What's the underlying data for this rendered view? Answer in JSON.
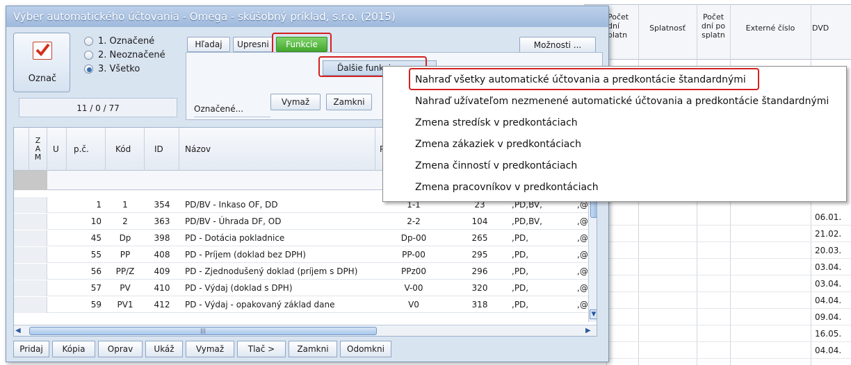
{
  "window": {
    "title": "Výber automatického účtovania - Omega - skúšobný príklad, s.r.o. (2015)"
  },
  "mark_button": {
    "label": "Označ",
    "icon": "checkbox-checked-icon"
  },
  "radios": [
    {
      "label": "1. Označené",
      "selected": false
    },
    {
      "label": "2. Neoznačené",
      "selected": false
    },
    {
      "label": "3. Všetko",
      "selected": true
    }
  ],
  "counter": "11 / 0 / 77",
  "tabs": [
    {
      "label": "Hľadaj"
    },
    {
      "label": "Upresni"
    },
    {
      "label": "Funkcie"
    }
  ],
  "options_button": "Možnosti ...",
  "submenu_button": "Ďalšie funkcie",
  "oznacene_label": "Označené...",
  "panel_buttons": {
    "delete": "Vymaž",
    "lock": "Zamkni"
  },
  "columns": {
    "zam": "Z\nA\nM",
    "u": "U",
    "pc": "p.č.",
    "kod": "Kód",
    "id": "ID",
    "nazov": "Názov",
    "pr": "Pr"
  },
  "rows": [
    {
      "pc": "1",
      "kod": "1",
      "id": "354",
      "nazov": "PD/BV - Inkaso OF, DD",
      "pr": "1-1",
      "n": "23",
      "typ": ",PD,BV,",
      "x": ",@"
    },
    {
      "pc": "10",
      "kod": "2",
      "id": "363",
      "nazov": "PD/BV - Úhrada DF, OD",
      "pr": "2-2",
      "n": "104",
      "typ": ",PD,BV,",
      "x": ",@"
    },
    {
      "pc": "45",
      "kod": "Dp",
      "id": "398",
      "nazov": "PD - Dotácia pokladnice",
      "pr": "Dp-00",
      "n": "265",
      "typ": ",PD,",
      "x": ",@"
    },
    {
      "pc": "55",
      "kod": "PP",
      "id": "408",
      "nazov": "PD - Príjem (doklad bez DPH)",
      "pr": "PP-00",
      "n": "295",
      "typ": ",PD,",
      "x": ",@"
    },
    {
      "pc": "56",
      "kod": "PP/Z",
      "id": "409",
      "nazov": "PD - Zjednodušený doklad (príjem s DPH)",
      "pr": "PPz00",
      "n": "296",
      "typ": ",PD,",
      "x": ",@"
    },
    {
      "pc": "57",
      "kod": "PV",
      "id": "410",
      "nazov": "PD - Výdaj (doklad s DPH)",
      "pr": "V-00",
      "n": "320",
      "typ": ",PD,",
      "x": ",@"
    },
    {
      "pc": "59",
      "kod": "PV1",
      "id": "412",
      "nazov": "PD - Výdaj - opakovaný základ dane",
      "pr": "V0",
      "n": "318",
      "typ": ",PD,",
      "x": ",@"
    }
  ],
  "bottom_buttons": [
    "Pridaj",
    "Kópia",
    "Oprav",
    "Ukáž",
    "Vymaž",
    "Tlač >",
    "Zamkni",
    "Odomkni"
  ],
  "menu_items": [
    "Nahraď všetky automatické účtovania a predkontácie štandardnými",
    "Nahraď užívateľom nezmenené automatické účtovania a predkontácie štandardnými",
    "Zmena stredísk v predkontáciach",
    "Zmena zákaziek v predkontáciach",
    "Zmena činností v predkontáciach",
    "Zmena pracovníkov v predkontáciach"
  ],
  "background_grid": {
    "headers": [
      "Počet dní platn",
      "Splatnosť",
      "Počet dní po splatn",
      "Externé číslo",
      "DVD"
    ],
    "dates": [
      "06.01.",
      "21.02.",
      "20.03.",
      "03.04.",
      "03.04.",
      "04.04.",
      "09.04.",
      "16.05.",
      "04.04."
    ]
  },
  "colors": {
    "accent_green": "#43a72e",
    "highlight_red": "#d42020",
    "title_blue": "#9fb9dc"
  }
}
